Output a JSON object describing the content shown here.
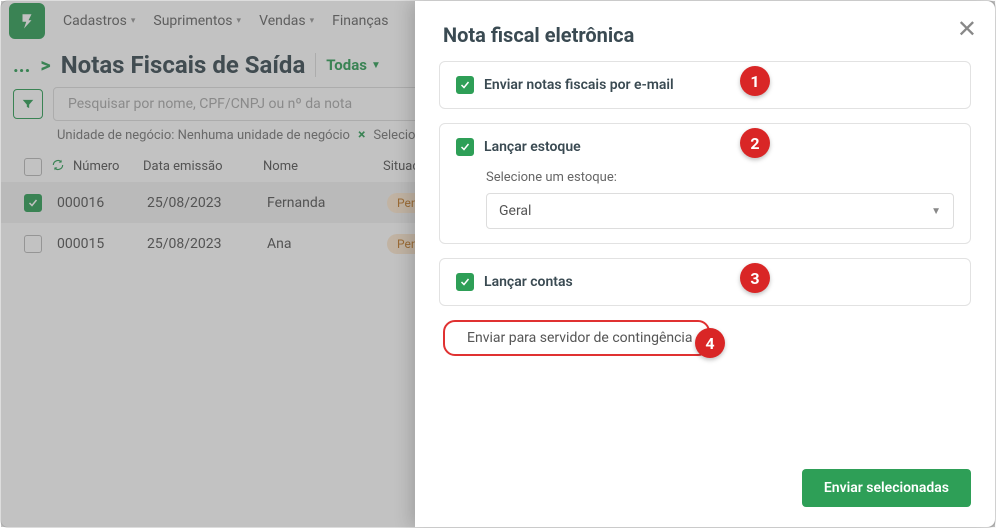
{
  "nav": {
    "items": [
      "Cadastros",
      "Suprimentos",
      "Vendas",
      "Finanças"
    ]
  },
  "page": {
    "breadcrumb_dots": "...",
    "breadcrumb_sep": ">",
    "title": "Notas Fiscais de Saída",
    "filter_label": "Todas"
  },
  "search": {
    "placeholder": "Pesquisar por nome, CPF/CNPJ ou nº da nota"
  },
  "subfilter": {
    "label": "Unidade de negócio: Nenhuma unidade de negócio",
    "extra": "Selecio"
  },
  "table": {
    "headers": {
      "num": "Número",
      "date": "Data emissão",
      "name": "Nome",
      "status": "Situaçã"
    },
    "rows": [
      {
        "num": "000016",
        "date": "25/08/2023",
        "name": "Fernanda",
        "status": "Pend",
        "checked": true
      },
      {
        "num": "000015",
        "date": "25/08/2023",
        "name": "Ana",
        "status": "Pend",
        "checked": false
      }
    ]
  },
  "modal": {
    "title": "Nota fiscal eletrônica",
    "opt_email": "Enviar notas fiscais por e-mail",
    "opt_estoque": "Lançar estoque",
    "stock_label": "Selecione um estoque:",
    "stock_value": "Geral",
    "opt_contas": "Lançar contas",
    "opt_conting": "Enviar para servidor de contingência",
    "submit": "Enviar selecionadas"
  },
  "callouts": [
    "1",
    "2",
    "3",
    "4"
  ]
}
